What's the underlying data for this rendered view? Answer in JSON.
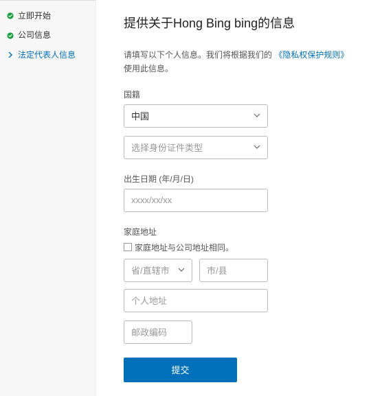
{
  "sidebar": {
    "items": [
      {
        "label": "立即开始",
        "status": "done"
      },
      {
        "label": "公司信息",
        "status": "done"
      },
      {
        "label": "法定代表人信息",
        "status": "current"
      }
    ]
  },
  "main": {
    "heading": "提供关于Hong Bing bing的信息",
    "desc_prefix": "请填写以下个人信息。我们将根据我们的",
    "desc_link": "《隐私权保护规则》",
    "desc_suffix": "使用此信息。",
    "nationality": {
      "label": "国籍",
      "value": "中国",
      "id_type_placeholder": "选择身份证件类型"
    },
    "dob": {
      "label": "出生日期 (年/月/日)",
      "placeholder": "xxxx/xx/xx"
    },
    "address": {
      "label": "家庭地址",
      "same_as_company": "家庭地址与公司地址相同。",
      "province_placeholder": "省/直辖市",
      "city_placeholder": "市/县",
      "street_placeholder": "个人地址",
      "postal_placeholder": "邮政编码"
    },
    "submit": "提交"
  },
  "icons": {
    "check": "check-icon",
    "arrow": "chevron-right-icon",
    "chevdown": "chevron-down-icon"
  },
  "colors": {
    "primary": "#0070ba",
    "green": "#1a9e3e"
  }
}
